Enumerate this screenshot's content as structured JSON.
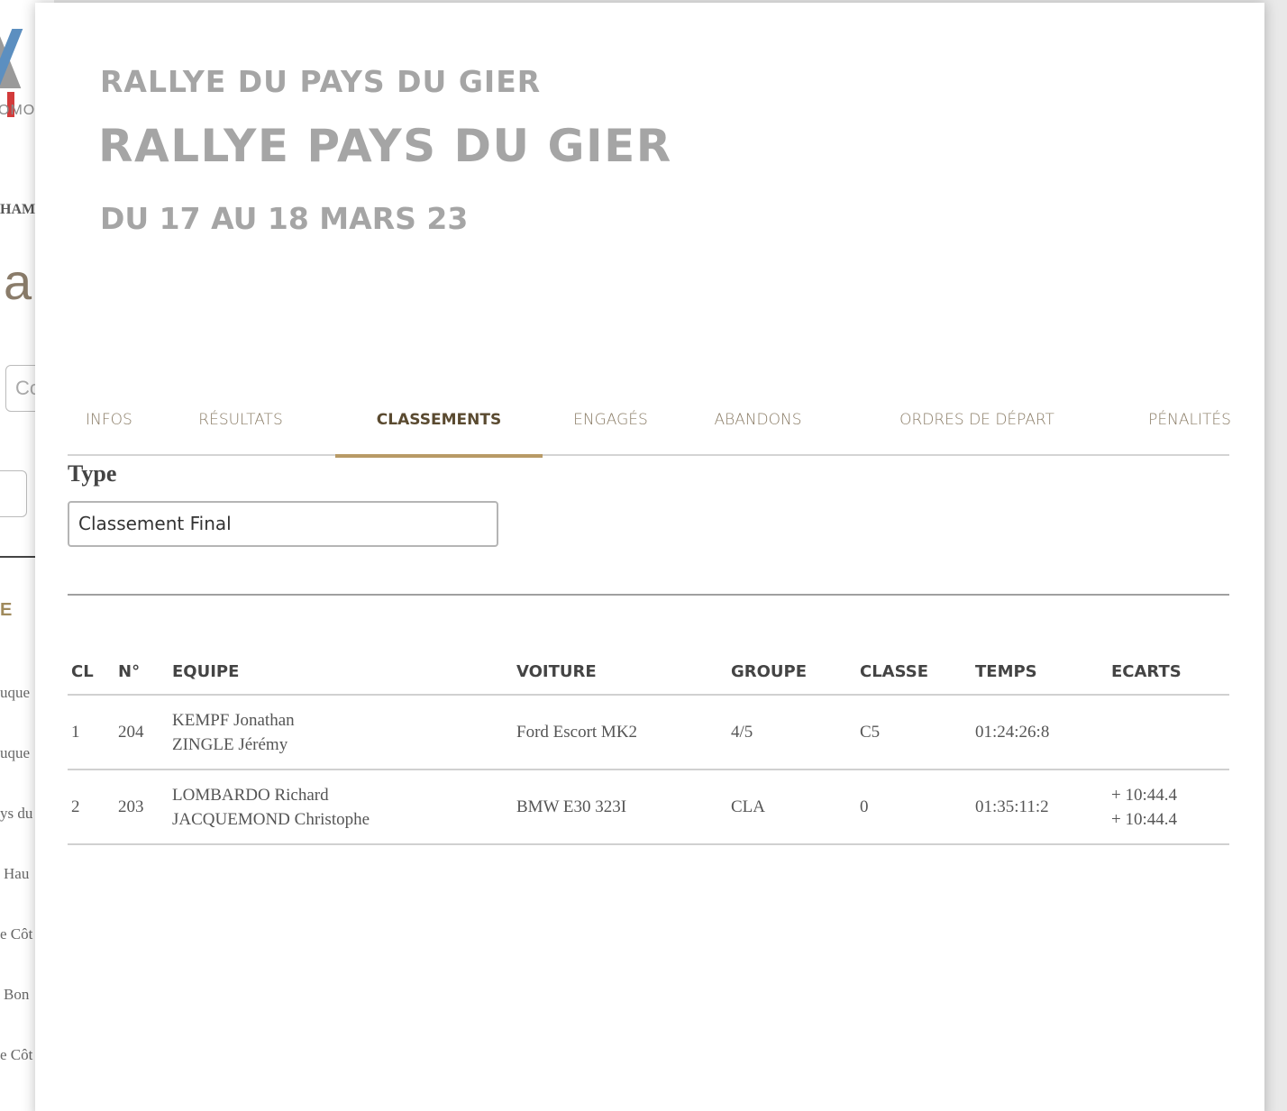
{
  "background": {
    "fragments": [
      "OMO",
      "HAM",
      "a",
      "Co",
      "E",
      "uque",
      "uque",
      "ys du",
      "Hau",
      "e Côt",
      "Bon",
      "e Côt"
    ]
  },
  "header": {
    "subtitle": "RALLYE DU PAYS DU GIER",
    "title": "RALLYE PAYS DU GIER",
    "dates": "DU 17 AU 18 MARS 23"
  },
  "tabs": [
    {
      "label": "INFOS"
    },
    {
      "label": "RÉSULTATS"
    },
    {
      "label": "CLASSEMENTS",
      "active": true
    },
    {
      "label": "ENGAGÉS"
    },
    {
      "label": "ABANDONS"
    },
    {
      "label": "ORDRES DE DÉPART"
    },
    {
      "label": "PÉNALITÉS"
    }
  ],
  "type_filter": {
    "label": "Type",
    "value": "Classement Final"
  },
  "table": {
    "headers": [
      "CL",
      "N°",
      "EQUIPE",
      "VOITURE",
      "GROUPE",
      "CLASSE",
      "TEMPS",
      "ECARTS"
    ],
    "rows": [
      {
        "cl": "1",
        "num": "204",
        "pilot": "KEMPF Jonathan",
        "copilot": "ZINGLE Jérémy",
        "car": "Ford Escort MK2",
        "group": "4/5",
        "class": "C5",
        "time": "01:24:26:8",
        "gap1": "",
        "gap2": ""
      },
      {
        "cl": "2",
        "num": "203",
        "pilot": "LOMBARDO Richard",
        "copilot": "JACQUEMOND Christophe",
        "car": "BMW E30 323I",
        "group": "CLA",
        "class": "0",
        "time": "01:35:11:2",
        "gap1": "+ 10:44.4",
        "gap2": "+ 10:44.4"
      }
    ]
  }
}
